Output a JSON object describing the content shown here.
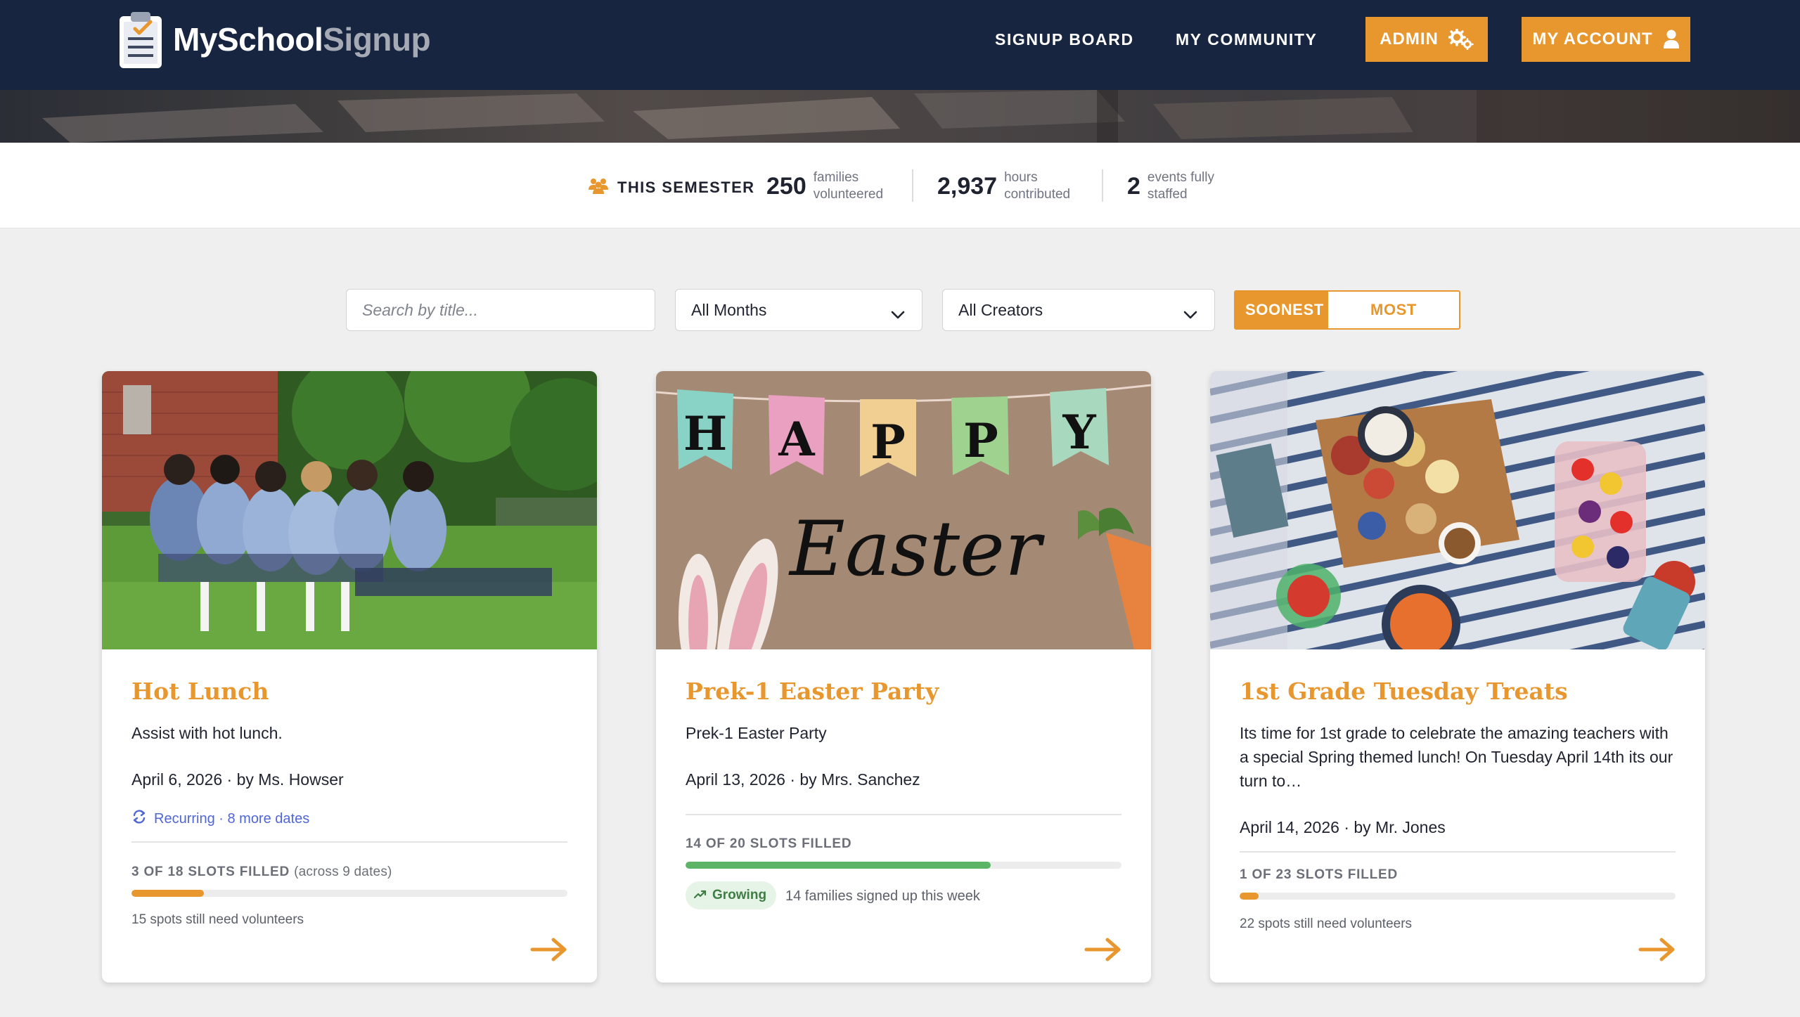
{
  "header": {
    "brand_my": "MySchool",
    "brand_signup": "Signup",
    "nav": {
      "signup_board": "SIGNUP BOARD",
      "my_community": "MY COMMUNITY",
      "admin": "ADMIN",
      "my_account": "MY ACCOUNT"
    },
    "logo_icon": "clipboard-check-icon",
    "admin_icon": "gears-icon",
    "account_icon": "user-icon"
  },
  "stats": {
    "label": "THIS SEMESTER",
    "label_icon": "people-icon",
    "items": [
      {
        "value": "250",
        "desc": "families volunteered"
      },
      {
        "value": "2,937",
        "desc": "hours contributed"
      },
      {
        "value": "2",
        "desc": "events fully staffed"
      }
    ]
  },
  "filters": {
    "search_placeholder": "Search by title...",
    "month_value": "All Months",
    "creator_value": "All Creators",
    "sort_options": [
      "SOONEST",
      "MOST NEEDED"
    ],
    "sort_selected": "SOONEST"
  },
  "cards": [
    {
      "title": "Hot Lunch",
      "description": "Assist with hot lunch.",
      "date_line": "April 6, 2026 · by Ms. Howser",
      "recurring": "Recurring · 8 more dates",
      "slots_label": "3 OF 18 SLOTS FILLED",
      "slots_sub": "(across 9 dates)",
      "filled": 3,
      "total": 18,
      "progress_color": "#e8972f",
      "need_text": "15 spots still need volunteers",
      "image": "students-sitting-on-grass"
    },
    {
      "title": "Prek-1 Easter Party",
      "description": "Prek-1 Easter Party",
      "date_line": "April 13, 2026 · by Mrs. Sanchez",
      "slots_label": "14 OF 20 SLOTS FILLED",
      "filled": 14,
      "total": 20,
      "progress_color": "#5cb466",
      "badge": "Growing",
      "badge_icon": "trending-up-icon",
      "badge_note": "14 families signed up this week",
      "image": "happy-easter-banner",
      "banner_letters": [
        "H",
        "A",
        "P",
        "P",
        "Y"
      ],
      "banner_script": "Easter"
    },
    {
      "title": "1st Grade Tuesday Treats",
      "description": "Its time for 1st grade to celebrate the amazing teachers with a special Spring themed lunch! On Tuesday April 14th its our turn to…",
      "date_line": "April 14, 2026 · by Mr. Jones",
      "slots_label": "1 OF 23 SLOTS FILLED",
      "filled": 1,
      "total": 23,
      "progress_color": "#e8972f",
      "need_text": "22 spots still need volunteers",
      "image": "picnic-blanket-food"
    }
  ],
  "colors": {
    "navy": "#172540",
    "accent": "#e8972f",
    "link_blue": "#4f66d6",
    "green": "#5cb466"
  }
}
